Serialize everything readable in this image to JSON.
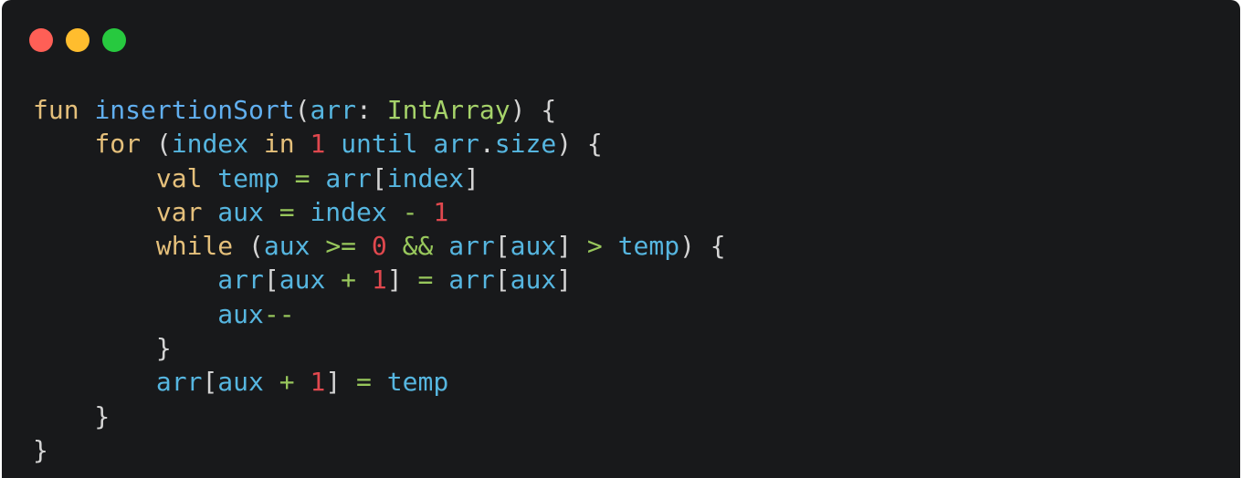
{
  "window": {
    "buttons": [
      {
        "name": "close",
        "color": "#ff5f56"
      },
      {
        "name": "minimize",
        "color": "#ffbd2e"
      },
      {
        "name": "maximize",
        "color": "#27c93f"
      }
    ]
  },
  "colors": {
    "background": "#18191b",
    "keyword": "#e5c07b",
    "function": "#61afef",
    "identifier": "#56b6e0",
    "type": "#a6d36a",
    "number": "#e0484e",
    "operator": "#98c75c",
    "punctuation": "#d4d4d4"
  },
  "code": {
    "language": "kotlin",
    "lines": [
      [
        [
          "kw",
          "fun"
        ],
        [
          "p",
          " "
        ],
        [
          "fn",
          "insertionSort"
        ],
        [
          "p",
          "("
        ],
        [
          "id",
          "arr"
        ],
        [
          "p",
          ": "
        ],
        [
          "ty",
          "IntArray"
        ],
        [
          "p",
          ") {"
        ]
      ],
      [
        [
          "p",
          "    "
        ],
        [
          "kw",
          "for"
        ],
        [
          "p",
          " ("
        ],
        [
          "id",
          "index"
        ],
        [
          "p",
          " "
        ],
        [
          "kw",
          "in"
        ],
        [
          "p",
          " "
        ],
        [
          "num",
          "1"
        ],
        [
          "p",
          " "
        ],
        [
          "id",
          "until"
        ],
        [
          "p",
          " "
        ],
        [
          "id",
          "arr"
        ],
        [
          "p",
          "."
        ],
        [
          "id",
          "size"
        ],
        [
          "p",
          ") {"
        ]
      ],
      [
        [
          "p",
          "        "
        ],
        [
          "kw",
          "val"
        ],
        [
          "p",
          " "
        ],
        [
          "id",
          "temp"
        ],
        [
          "p",
          " "
        ],
        [
          "op",
          "="
        ],
        [
          "p",
          " "
        ],
        [
          "id",
          "arr"
        ],
        [
          "p",
          "["
        ],
        [
          "id",
          "index"
        ],
        [
          "p",
          "]"
        ]
      ],
      [
        [
          "p",
          "        "
        ],
        [
          "kw",
          "var"
        ],
        [
          "p",
          " "
        ],
        [
          "id",
          "aux"
        ],
        [
          "p",
          " "
        ],
        [
          "op",
          "="
        ],
        [
          "p",
          " "
        ],
        [
          "id",
          "index"
        ],
        [
          "p",
          " "
        ],
        [
          "op",
          "-"
        ],
        [
          "p",
          " "
        ],
        [
          "num",
          "1"
        ]
      ],
      [
        [
          "p",
          "        "
        ],
        [
          "kw",
          "while"
        ],
        [
          "p",
          " ("
        ],
        [
          "id",
          "aux"
        ],
        [
          "p",
          " "
        ],
        [
          "op",
          ">="
        ],
        [
          "p",
          " "
        ],
        [
          "num",
          "0"
        ],
        [
          "p",
          " "
        ],
        [
          "op",
          "&&"
        ],
        [
          "p",
          " "
        ],
        [
          "id",
          "arr"
        ],
        [
          "p",
          "["
        ],
        [
          "id",
          "aux"
        ],
        [
          "p",
          "] "
        ],
        [
          "op",
          ">"
        ],
        [
          "p",
          " "
        ],
        [
          "id",
          "temp"
        ],
        [
          "p",
          ") {"
        ]
      ],
      [
        [
          "p",
          "            "
        ],
        [
          "id",
          "arr"
        ],
        [
          "p",
          "["
        ],
        [
          "id",
          "aux"
        ],
        [
          "p",
          " "
        ],
        [
          "op",
          "+"
        ],
        [
          "p",
          " "
        ],
        [
          "num",
          "1"
        ],
        [
          "p",
          "] "
        ],
        [
          "op",
          "="
        ],
        [
          "p",
          " "
        ],
        [
          "id",
          "arr"
        ],
        [
          "p",
          "["
        ],
        [
          "id",
          "aux"
        ],
        [
          "p",
          "]"
        ]
      ],
      [
        [
          "p",
          "            "
        ],
        [
          "id",
          "aux"
        ],
        [
          "op",
          "--"
        ]
      ],
      [
        [
          "p",
          "        }"
        ]
      ],
      [
        [
          "p",
          "        "
        ],
        [
          "id",
          "arr"
        ],
        [
          "p",
          "["
        ],
        [
          "id",
          "aux"
        ],
        [
          "p",
          " "
        ],
        [
          "op",
          "+"
        ],
        [
          "p",
          " "
        ],
        [
          "num",
          "1"
        ],
        [
          "p",
          "] "
        ],
        [
          "op",
          "="
        ],
        [
          "p",
          " "
        ],
        [
          "id",
          "temp"
        ]
      ],
      [
        [
          "p",
          "    }"
        ]
      ],
      [
        [
          "p",
          "}"
        ]
      ]
    ]
  }
}
